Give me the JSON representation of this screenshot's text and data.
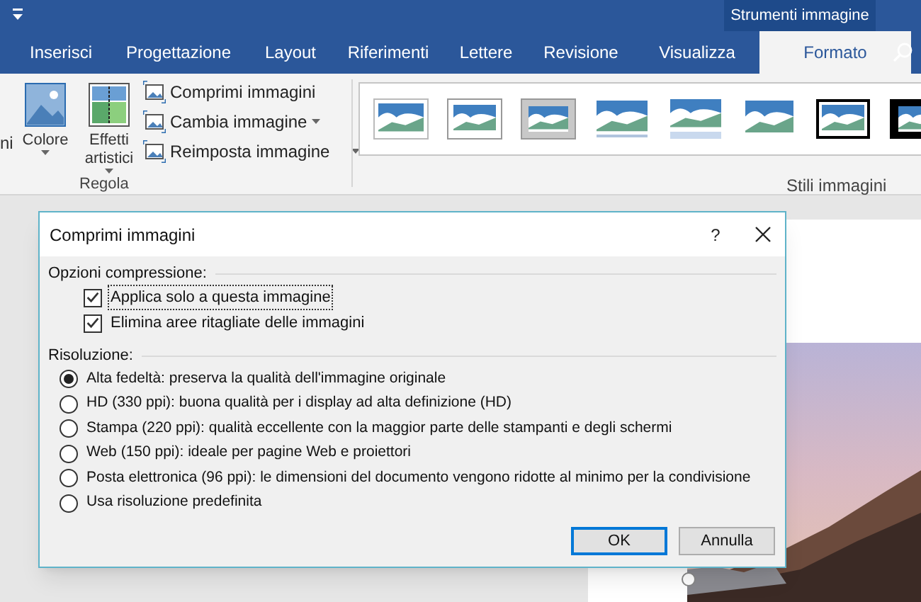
{
  "context_tab": {
    "label": "Strumenti immagine"
  },
  "tabs": [
    {
      "label": "Inserisci",
      "selected": false
    },
    {
      "label": "Progettazione",
      "selected": false
    },
    {
      "label": "Layout",
      "selected": false
    },
    {
      "label": "Riferimenti",
      "selected": false
    },
    {
      "label": "Lettere",
      "selected": false
    },
    {
      "label": "Revisione",
      "selected": false
    },
    {
      "label": "Visualizza",
      "selected": false
    },
    {
      "label": "Formato",
      "selected": true
    }
  ],
  "ribbon": {
    "cut_label": "ni",
    "large_buttons": [
      {
        "label": "Colore",
        "kind": "color"
      },
      {
        "label": "Effetti artistici",
        "kind": "effects"
      }
    ],
    "small_buttons": [
      {
        "label": "Comprimi immagini",
        "dropdown": false
      },
      {
        "label": "Cambia immagine",
        "dropdown": true
      },
      {
        "label": "Reimposta immagine",
        "dropdown": true
      }
    ],
    "group_label": "Regola",
    "styles": [
      {
        "kind": "plain"
      },
      {
        "kind": "white-frame"
      },
      {
        "kind": "grey-frame"
      },
      {
        "kind": "soft"
      },
      {
        "kind": "reflection"
      },
      {
        "kind": "feathered"
      },
      {
        "kind": "black-frame"
      },
      {
        "kind": "thick-black"
      }
    ],
    "styles_label": "Stili immagini"
  },
  "dialog": {
    "title": "Comprimi immagini",
    "help": "?",
    "options_heading": "Opzioni compressione:",
    "options": [
      {
        "label": "Applica solo a questa immagine",
        "checked": true,
        "focused": true
      },
      {
        "label": "Elimina aree ritagliate delle immagini",
        "checked": true,
        "focused": false
      }
    ],
    "resolution_heading": "Risoluzione:",
    "resolutions": [
      {
        "label": "Alta fedeltà: preserva la qualità dell'immagine originale",
        "selected": true
      },
      {
        "label": "HD (330 ppi): buona qualità per i display ad alta definizione (HD)",
        "selected": false
      },
      {
        "label": "Stampa (220 ppi): qualità eccellente con la maggior parte delle stampanti e degli schermi",
        "selected": false
      },
      {
        "label": "Web (150 ppi): ideale per pagine Web e proiettori",
        "selected": false
      },
      {
        "label": "Posta elettronica (96 ppi): le dimensioni del documento vengono ridotte al minimo per la condivisione",
        "selected": false
      },
      {
        "label": "Usa risoluzione predefinita",
        "selected": false
      }
    ],
    "buttons": [
      {
        "label": "OK",
        "default": true
      },
      {
        "label": "Annulla",
        "default": false
      }
    ]
  }
}
